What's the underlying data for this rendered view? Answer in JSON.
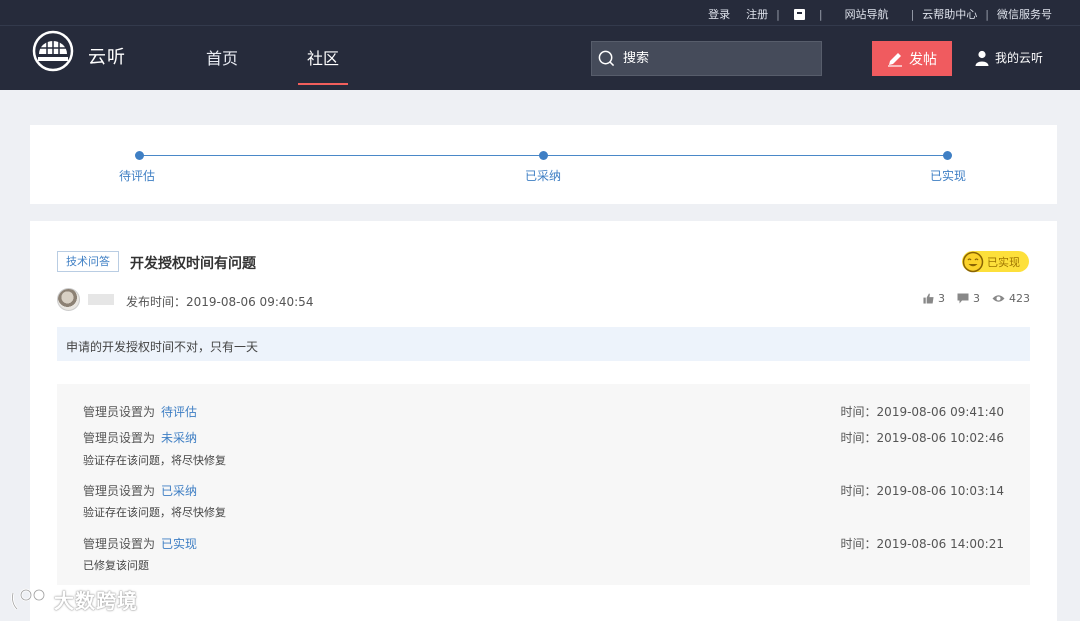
{
  "topbar": {
    "login": "登录",
    "register": "注册",
    "site_nav": "网站导航",
    "help_center": "云帮助中心",
    "wechat": "微信服务号"
  },
  "header": {
    "brand": "云听",
    "nav": {
      "home": "首页",
      "community": "社区"
    },
    "search_placeholder": "搜索",
    "post_button": "发帖",
    "my_cloud": "我的云听"
  },
  "progress": {
    "steps": [
      "待评估",
      "已采纳",
      "已实现"
    ]
  },
  "post": {
    "tag": "技术问答",
    "title": "开发授权时间有问题",
    "status_badge": "已实现",
    "publish_time": "发布时间：2019-08-06 09:40:54",
    "likes": "3",
    "comments": "3",
    "views": "423",
    "content": "申请的开发授权时间不对，只有一天"
  },
  "history": [
    {
      "action": "管理员设置为",
      "status": "待评估",
      "time": "时间：2019-08-06 09:41:40",
      "note": ""
    },
    {
      "action": "管理员设置为",
      "status": "未采纳",
      "time": "时间：2019-08-06 10:02:46",
      "note": "验证存在该问题，将尽快修复"
    },
    {
      "action": "管理员设置为",
      "status": "已采纳",
      "time": "时间：2019-08-06 10:03:14",
      "note": "验证存在该问题，将尽快修复"
    },
    {
      "action": "管理员设置为",
      "status": "已实现",
      "time": "时间：2019-08-06 14:00:21",
      "note": "已修复该问题"
    }
  ],
  "watermark": "大数跨境",
  "colors": {
    "header_bg": "#262b3b",
    "accent_red": "#f05b5f",
    "link_blue": "#3f7fc4",
    "badge_yellow": "#fde03b"
  }
}
